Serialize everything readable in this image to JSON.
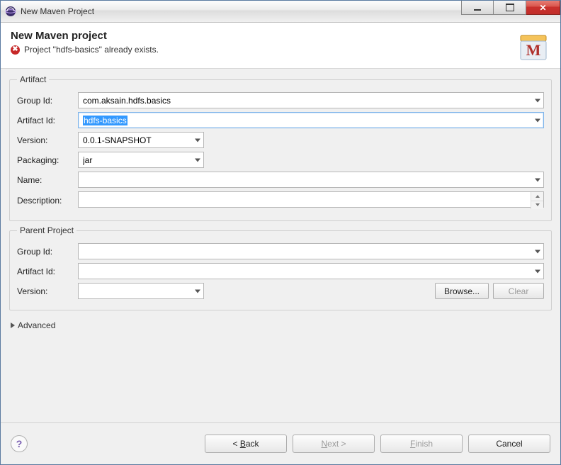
{
  "window": {
    "title": "New Maven Project"
  },
  "banner": {
    "heading": "New Maven project",
    "error_message": "Project \"hdfs-basics\" already exists."
  },
  "artifact": {
    "legend": "Artifact",
    "labels": {
      "group_id": "Group Id:",
      "artifact_id": "Artifact Id:",
      "version": "Version:",
      "packaging": "Packaging:",
      "name": "Name:",
      "description": "Description:"
    },
    "values": {
      "group_id": "com.aksain.hdfs.basics",
      "artifact_id": "hdfs-basics",
      "version": "0.0.1-SNAPSHOT",
      "packaging": "jar",
      "name": "",
      "description": ""
    }
  },
  "parent": {
    "legend": "Parent Project",
    "labels": {
      "group_id": "Group Id:",
      "artifact_id": "Artifact Id:",
      "version": "Version:"
    },
    "values": {
      "group_id": "",
      "artifact_id": "",
      "version": ""
    },
    "buttons": {
      "browse": "Browse...",
      "clear": "Clear"
    }
  },
  "advanced_label": "Advanced",
  "nav": {
    "back": "< Back",
    "next": "Next >",
    "finish": "Finish",
    "cancel": "Cancel"
  }
}
